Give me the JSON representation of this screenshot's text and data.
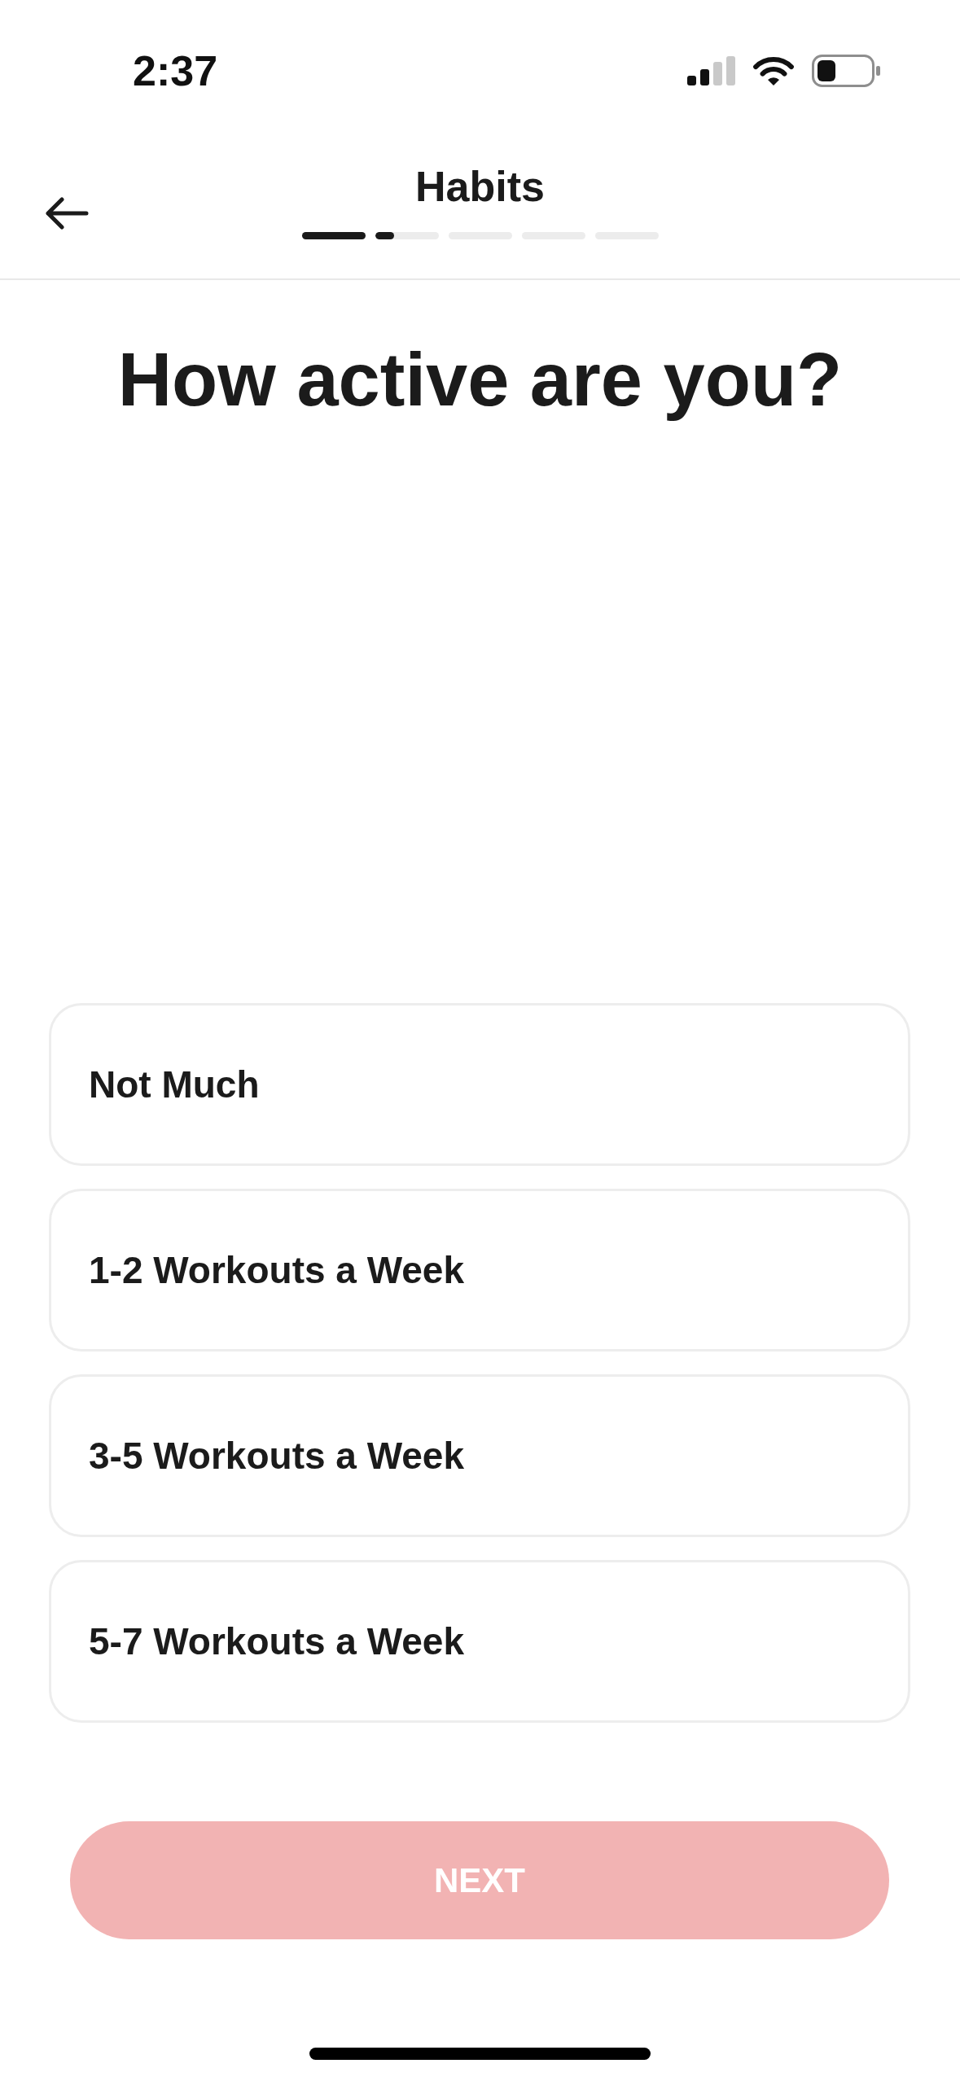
{
  "status_bar": {
    "time": "2:37"
  },
  "header": {
    "title": "Habits",
    "progress": [
      {
        "kind": "done"
      },
      {
        "kind": "current",
        "level": 0.3
      },
      {
        "kind": "upcoming"
      },
      {
        "kind": "upcoming"
      },
      {
        "kind": "upcoming"
      }
    ]
  },
  "question": "How active are you?",
  "options": [
    {
      "label": "Not Much",
      "selected": false
    },
    {
      "label": "1-2 Workouts a Week",
      "selected": false
    },
    {
      "label": "3-5 Workouts a Week",
      "selected": false
    },
    {
      "label": "5-7 Workouts a Week",
      "selected": false
    }
  ],
  "next_button": {
    "label": "NEXT",
    "disabled": true
  }
}
